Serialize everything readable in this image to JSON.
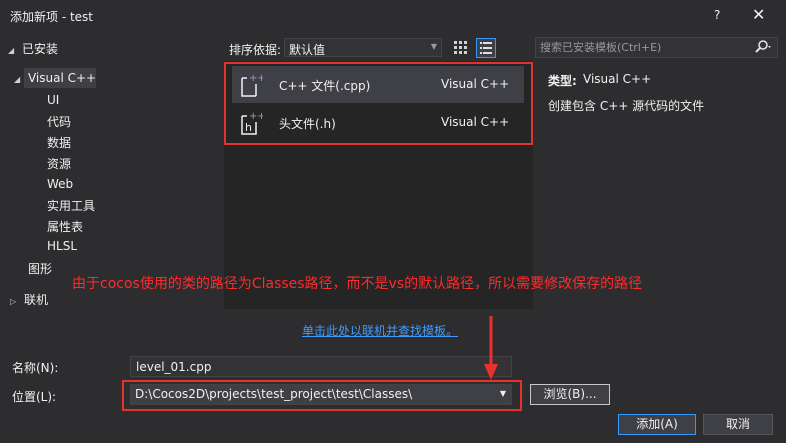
{
  "window": {
    "title": "添加新项 - test",
    "help_label": "?",
    "close_glyph": "✕"
  },
  "sidebar": {
    "installed_label": "已安装",
    "online_label": "联机",
    "items": [
      {
        "label": "Visual C++"
      },
      {
        "label": "UI"
      },
      {
        "label": "代码"
      },
      {
        "label": "数据"
      },
      {
        "label": "资源"
      },
      {
        "label": "Web"
      },
      {
        "label": "实用工具"
      },
      {
        "label": "属性表"
      },
      {
        "label": "HLSL"
      },
      {
        "label": "图形"
      }
    ]
  },
  "toolbar": {
    "sort_label": "排序依据:",
    "sort_value": "默认值",
    "grid_icon": "grid-view-icon",
    "list_icon": "list-view-icon"
  },
  "search": {
    "placeholder": "搜索已安装模板(Ctrl+E)",
    "icon": "search-icon"
  },
  "templates": [
    {
      "name": "C++ 文件(.cpp)",
      "language": "Visual C++",
      "icon": "cpp-file-icon",
      "selected": true
    },
    {
      "name": "头文件(.h)",
      "language": "Visual C++",
      "icon": "header-file-icon",
      "selected": false
    }
  ],
  "info": {
    "type_label": "类型:",
    "type_value": "Visual C++",
    "description": "创建包含 C++ 源代码的文件"
  },
  "annotation": {
    "text": "由于cocos使用的类的路径为Classes路径，而不是vs的默认路径，所以需要修改保存的路径"
  },
  "online_link": "单击此处以联机并查找模板。",
  "form": {
    "name_label": "名称(N):",
    "name_value": "level_01.cpp",
    "location_label": "位置(L):",
    "location_value": "D:\\Cocos2D\\projects\\test_project\\test\\Classes\\",
    "browse_label": "浏览(B)...",
    "add_label": "添加(A)",
    "cancel_label": "取消"
  },
  "colors": {
    "background": "#2d2d30",
    "panel": "#252526",
    "selection": "#3f3f46",
    "annotation_red": "#e5322d",
    "link_blue": "#3e9cff",
    "accent_blue": "#3399ff"
  }
}
